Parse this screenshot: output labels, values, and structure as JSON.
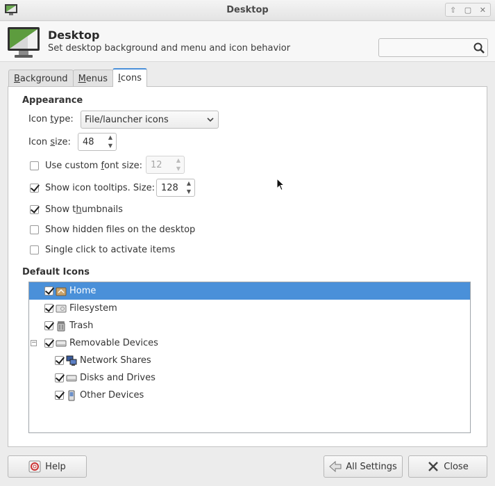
{
  "window": {
    "title": "Desktop",
    "controls": [
      "up-icon",
      "maximize-icon",
      "close-icon"
    ]
  },
  "header": {
    "title": "Desktop",
    "subtitle": "Set desktop background and menu and icon behavior",
    "search": {
      "value": "",
      "placeholder": "",
      "icon": "search-icon"
    }
  },
  "tabs": [
    {
      "label": "Background",
      "mnemonic": "B",
      "rest": "ackground",
      "active": false
    },
    {
      "label": "Menus",
      "mnemonic": "M",
      "rest": "enus",
      "active": false
    },
    {
      "label": "Icons",
      "mnemonic": "I",
      "rest": "cons",
      "active": true
    }
  ],
  "appearance": {
    "heading": "Appearance",
    "icon_type_label_pre": "Icon ",
    "icon_type_label_mn": "t",
    "icon_type_label_post": "ype:",
    "icon_type_value": "File/launcher icons",
    "icon_size_label_pre": "Icon ",
    "icon_size_label_mn": "s",
    "icon_size_label_post": "ize:",
    "icon_size_value": "48",
    "custom_font": {
      "pre": "Use custom ",
      "mn": "f",
      "post": "ont size:",
      "checked": false,
      "value": "12"
    },
    "tooltips": {
      "label": "Show icon tooltips. Size:",
      "checked": true,
      "value": "128"
    },
    "thumbnails": {
      "pre": "Show t",
      "mn": "h",
      "post": "umbnails",
      "checked": true
    },
    "hidden_files": {
      "label": "Show hidden files on the desktop",
      "checked": false
    },
    "single_click": {
      "label": "Single click to activate items",
      "checked": false
    }
  },
  "default_icons": {
    "heading": "Default Icons",
    "items": [
      {
        "label": "Home",
        "checked": true,
        "icon": "home-icon",
        "selected": true,
        "level": 0
      },
      {
        "label": "Filesystem",
        "checked": true,
        "icon": "drive-icon",
        "selected": false,
        "level": 0
      },
      {
        "label": "Trash",
        "checked": true,
        "icon": "trash-icon",
        "selected": false,
        "level": 0
      },
      {
        "label": "Removable Devices",
        "checked": true,
        "icon": "drive-icon",
        "selected": false,
        "level": 0,
        "expander": "−"
      },
      {
        "label": "Network Shares",
        "checked": true,
        "icon": "network-icon",
        "selected": false,
        "level": 1
      },
      {
        "label": "Disks and Drives",
        "checked": true,
        "icon": "drive-icon",
        "selected": false,
        "level": 1
      },
      {
        "label": "Other Devices",
        "checked": true,
        "icon": "phone-icon",
        "selected": false,
        "level": 1
      }
    ]
  },
  "footer": {
    "help_label": "Help",
    "all_settings_label": "All Settings",
    "close_label": "Close"
  },
  "colors": {
    "accent": "#4a90d9",
    "window_bg": "#ececec",
    "panel_bg": "#ffffff"
  }
}
